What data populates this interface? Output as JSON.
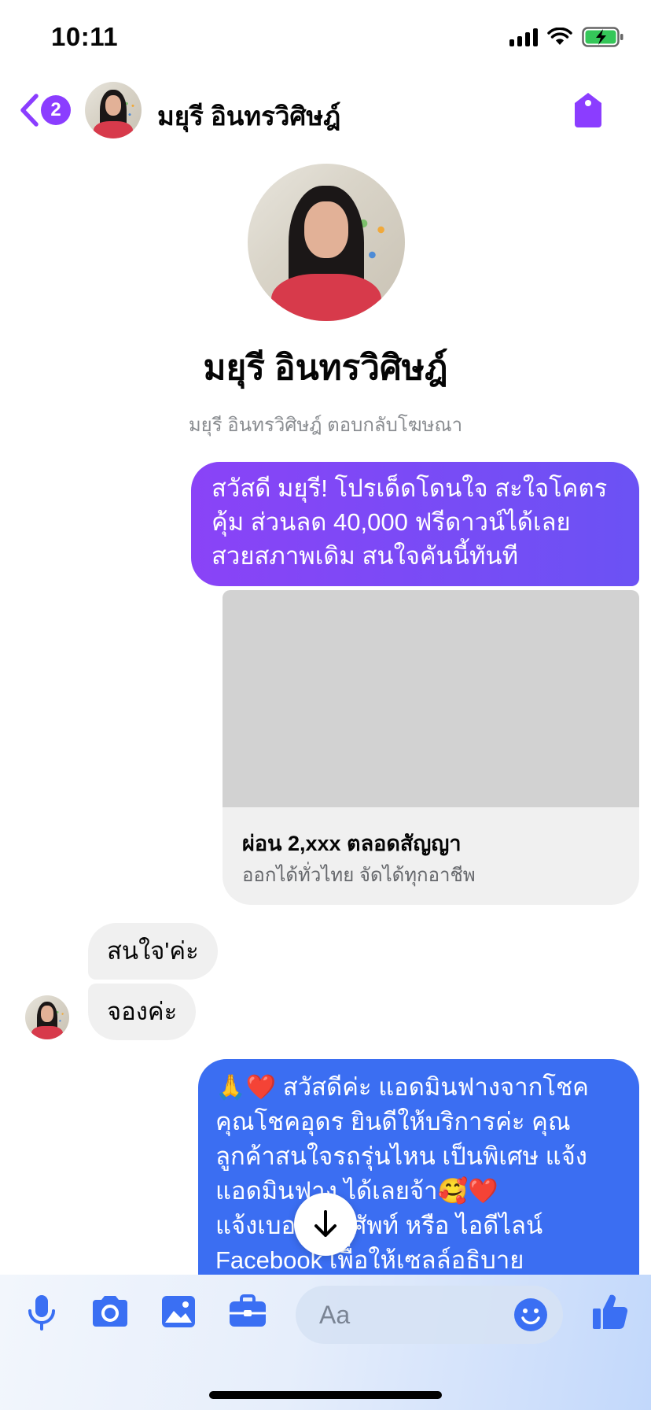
{
  "status": {
    "time": "10:11"
  },
  "header": {
    "back_badge": "2",
    "name": "มยุรี อินทรวิศิษฎ์"
  },
  "profile": {
    "name": "มยุรี อินทรวิศิษฎ์",
    "subtitle": "มยุรี อินทรวิศิษฎ์ ตอบกลับโฆษณา"
  },
  "messages": {
    "out1": [
      "สวัสดี มยุรี! โปรเด็ดโดนใจ สะใจโคตร",
      "คุ้ม ส่วนลด 40,000 ฟรีดาวน์ได้เลย",
      "สวยสภาพเดิม สนใจคันนี้ทันที"
    ],
    "card": {
      "title": "ผ่อน 2,xxx ตลอดสัญญา",
      "subtitle": "ออกได้ทั่วไทย จัดได้ทุกอาชีพ"
    },
    "in1": "สนใจ'ค่ะ",
    "in2": "จองค่ะ",
    "out2": [
      "🙏❤️ สวัสดีค่ะ แอดมินฟางจากโชค",
      "คุณโชคอุดร ยินดีให้บริการค่ะ   คุณ",
      "ลูกค้าสนใจรถรุ่นไหน เป็นพิเศษ แจ้ง",
      "แอดมินฟาง ได้เลยจ้า🥰❤️",
      "แจ้งเบอร์โทรศัพท์ หรือ ไอดีไลน์",
      "Facebook   เพื่อให้เซลล์อธิบาย"
    ]
  },
  "composer": {
    "placeholder": "Aa"
  },
  "colors": {
    "accent": "#8b3dff",
    "outgoing_gradient_start": "#8a43f7",
    "outgoing_gradient_end": "#6b52f4",
    "outgoing_blue": "#3b6ef2",
    "incoming": "#f0f0f0",
    "icon_blue": "#3a6ff3"
  }
}
